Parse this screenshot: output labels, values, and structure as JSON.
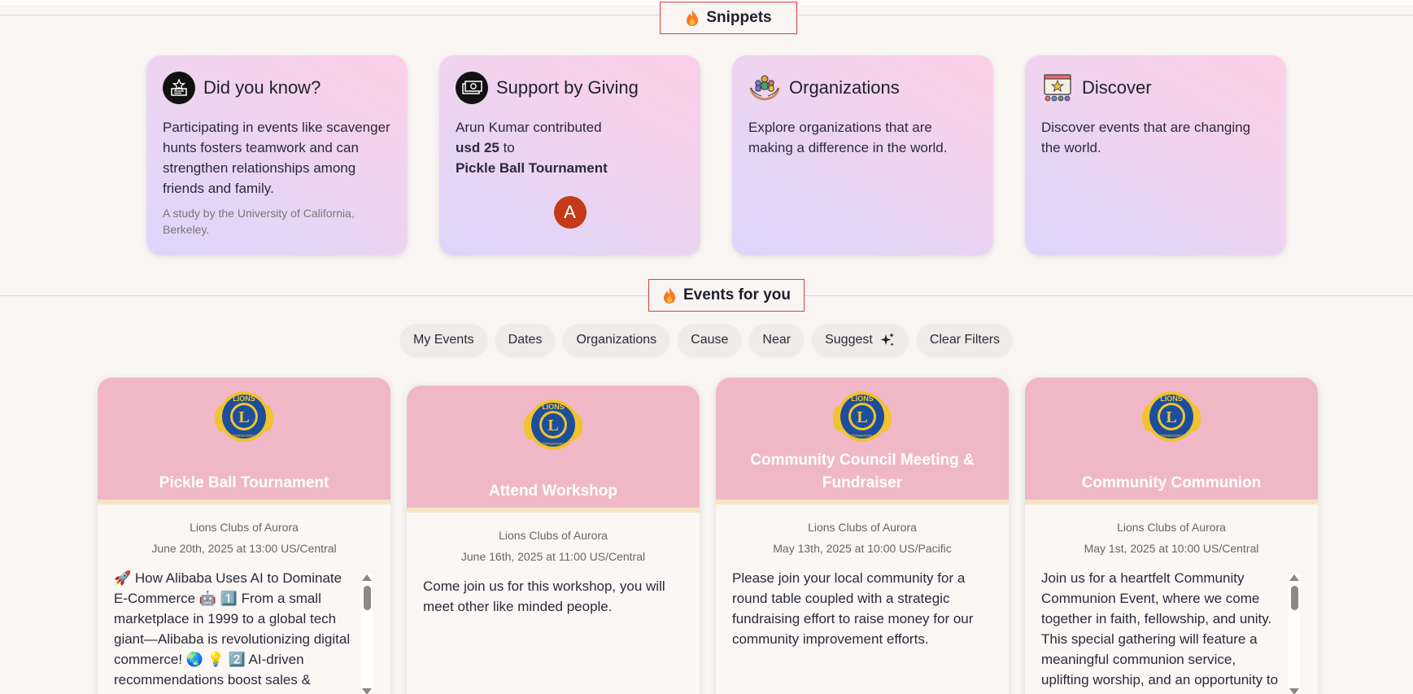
{
  "sections": {
    "snippets_title": "Snippets",
    "events_title": "Events for you"
  },
  "snippets": [
    {
      "title": "Did you know?",
      "icon": "award-certificate-icon",
      "body": "Participating in events like scavenger hunts fosters teamwork and can strengthen relationships among friends and family.",
      "note": "A study by the University of California, Berkeley."
    },
    {
      "title": "Support by Giving",
      "icon": "money-bill-icon",
      "body_line1": "Arun Kumar contributed",
      "amount": "usd 25",
      "to": " to",
      "event": "Pickle Ball Tournament",
      "avatar_letter": "A"
    },
    {
      "title": "Organizations",
      "icon": "community-hands-icon",
      "body": "Explore organizations that are making a difference in the world."
    },
    {
      "title": "Discover",
      "icon": "event-stage-icon",
      "body": "Discover events that are changing the world."
    }
  ],
  "filters": [
    "My Events",
    "Dates",
    "Organizations",
    "Cause",
    "Near",
    "Suggest",
    "Clear Filters"
  ],
  "events": [
    {
      "title": "Pickle Ball Tournament",
      "org": "Lions Clubs of Aurora",
      "date": "June 20th, 2025 at 13:00 US/Central",
      "description": "🚀 How Alibaba Uses AI to Dominate E-Commerce 🤖 1️⃣ From a small marketplace in 1999 to a global tech giant—Alibaba is revolutionizing digital commerce! 🌏 💡 2️⃣ AI-driven recommendations boost sales & enhance"
    },
    {
      "title": "Attend Workshop",
      "org": "Lions Clubs of Aurora",
      "date": "June 16th, 2025 at 11:00 US/Central",
      "description": "Come join us for this workshop, you will meet other like minded people."
    },
    {
      "title": "Community Council Meeting & Fundraiser",
      "org": "Lions Clubs of Aurora",
      "date": "May 13th, 2025 at 10:00 US/Pacific",
      "description": "Please join your local community for a round table coupled with a strategic fundraising effort to raise money for our community improvement efforts."
    },
    {
      "title": "Community Communion",
      "org": "Lions Clubs of Aurora",
      "date": "May 1st, 2025 at 10:00 US/Central",
      "description": "Join us for a heartfelt Community Communion Event, where we come together in faith, fellowship, and unity. This special gathering will feature a meaningful communion service, uplifting worship, and an opportunity to connect"
    }
  ],
  "logo_text": "LIONS",
  "logo_sub": "INTERNATIONAL",
  "logo_letter": "L",
  "colors": {
    "accent_red": "#e23b3b",
    "card_header_pink": "#f0b8c7",
    "avatar": "#c23a17",
    "lions_blue": "#1b4f9c",
    "lions_gold": "#f2c230"
  }
}
